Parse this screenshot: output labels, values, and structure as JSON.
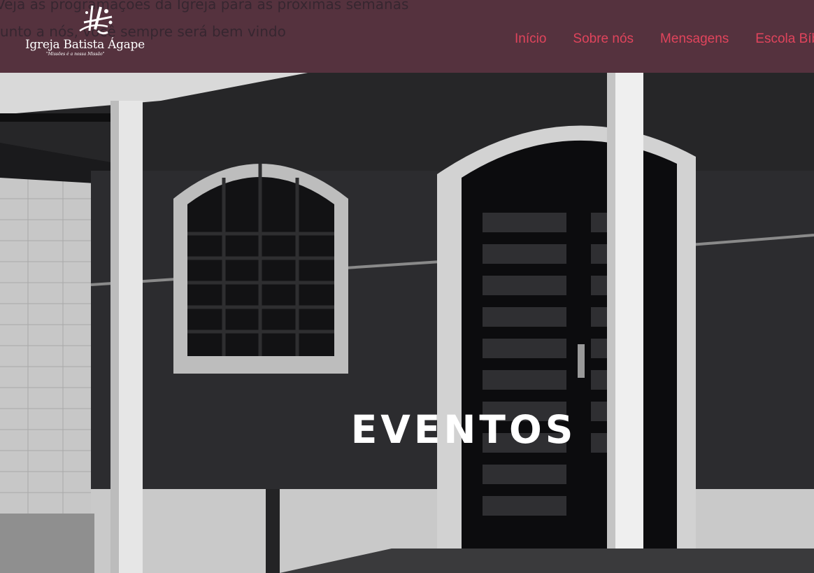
{
  "header": {
    "ghost_line_1": "Veja as programações da Igreja para as próximas semanas",
    "ghost_line_2": "Junto a nós, você sempre será bem vindo",
    "logo": {
      "name": "Igreja Batista Ágape",
      "tagline": "\"Missões é a nossa Missão\""
    },
    "nav": [
      {
        "label": "Início"
      },
      {
        "label": "Sobre nós"
      },
      {
        "label": "Mensagens"
      },
      {
        "label": "Escola Bíblica"
      }
    ]
  },
  "hero": {
    "title": "EVENTOS"
  },
  "colors": {
    "header_bg": "#55323e",
    "nav_link": "#e0445c",
    "hero_title": "#ffffff"
  },
  "icons": {
    "logo_mark": "brush-stroke-logo-icon"
  }
}
